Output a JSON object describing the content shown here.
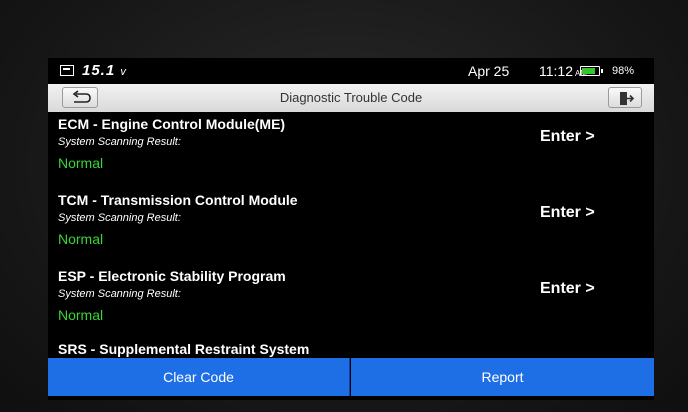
{
  "status_bar": {
    "voltage": "15.1",
    "voltage_unit": "v",
    "date": "Apr 25",
    "time": "11:12",
    "ampm": "AM",
    "battery_percent": "98%",
    "battery_level": 0.98
  },
  "title_bar": {
    "title": "Diagnostic Trouble Code",
    "back_icon": "back-arrow-icon",
    "exit_icon": "exit-icon"
  },
  "systems": [
    {
      "name": "ECM - Engine Control Module(ME)",
      "scan_label": "System Scanning Result:",
      "status": "Normal",
      "action": "Enter >"
    },
    {
      "name": "TCM - Transmission Control Module",
      "scan_label": "System Scanning Result:",
      "status": "Normal",
      "action": "Enter >"
    },
    {
      "name": "ESP - Electronic Stability Program",
      "scan_label": "System Scanning Result:",
      "status": "Normal",
      "action": "Enter >"
    },
    {
      "name": "SRS - Supplemental Restraint System"
    }
  ],
  "footer": {
    "clear_label": "Clear Code",
    "report_label": "Report"
  },
  "colors": {
    "accent": "#1e6fe6",
    "status_ok": "#3bd43b",
    "battery": "#34c72b"
  }
}
